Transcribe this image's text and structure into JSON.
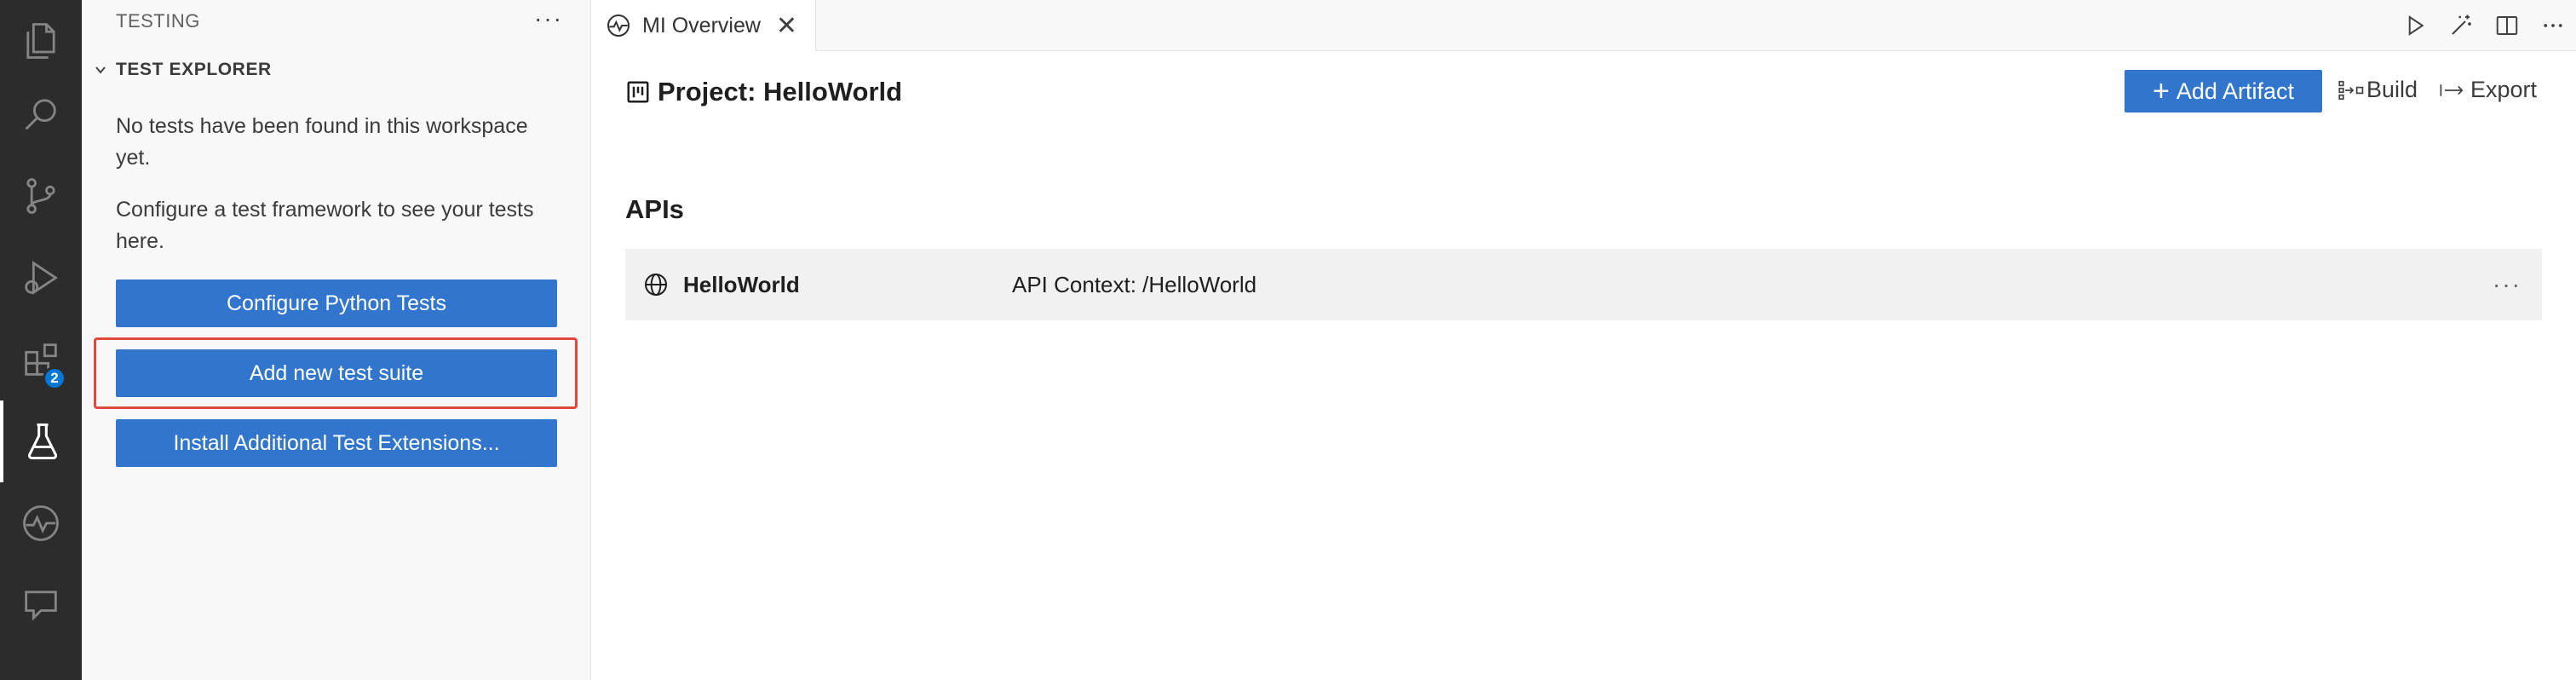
{
  "activity_bar": {
    "items": [
      {
        "icon": "explorer-icon"
      },
      {
        "icon": "search-icon"
      },
      {
        "icon": "source-control-icon"
      },
      {
        "icon": "run-debug-icon"
      },
      {
        "icon": "extensions-icon",
        "badge": "2"
      },
      {
        "icon": "testing-flask-icon",
        "active": true
      },
      {
        "icon": "mi-pulse-icon"
      },
      {
        "icon": "remote-explorer-icon"
      }
    ],
    "accent_color": "#0078d4"
  },
  "sidebar": {
    "header": "TESTING",
    "more_label": "···",
    "section_title": "TEST EXPLORER",
    "message_1": "No tests have been found in this workspace yet.",
    "message_2": "Configure a test framework to see your tests here.",
    "buttons": [
      "Configure Python Tests",
      "Add new test suite",
      "Install Additional Test Extensions..."
    ],
    "highlight_color": "#e0483e",
    "button_color": "#3176cc"
  },
  "tabs": {
    "active_tab": "MI Overview",
    "close_glyph": "✕",
    "actions": [
      "run-icon",
      "magic-wand-icon",
      "split-editor-icon",
      "more-actions-icon"
    ]
  },
  "editor": {
    "project_title": "Project: HelloWorld",
    "add_artifact_label": "Add Artifact",
    "build_label": "Build",
    "export_label": "Export",
    "apis_title": "APIs",
    "apis": [
      {
        "name": "HelloWorld",
        "context": "API Context: /HelloWorld",
        "more": "···"
      }
    ]
  }
}
